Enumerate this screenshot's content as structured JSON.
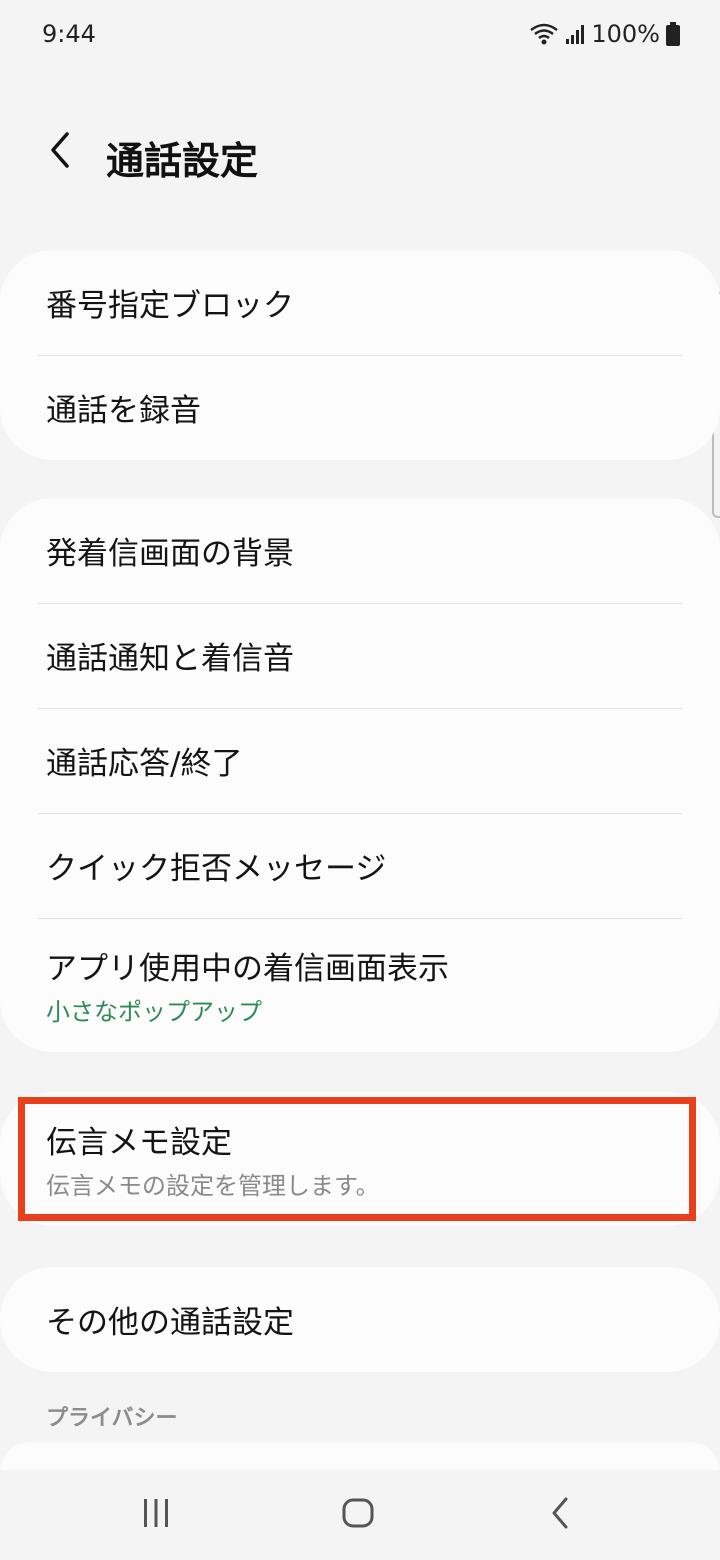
{
  "status_bar": {
    "time": "9:44",
    "battery": "100%",
    "icons": [
      "wifi-icon",
      "signal-icon",
      "battery-icon"
    ]
  },
  "header": {
    "back_icon": "chevron-left-icon",
    "title": "通話設定"
  },
  "group1": {
    "items": [
      {
        "label": "番号指定ブロック"
      },
      {
        "label": "通話を録音"
      }
    ]
  },
  "group2": {
    "items": [
      {
        "label": "発着信画面の背景"
      },
      {
        "label": "通話通知と着信音"
      },
      {
        "label": "通話応答/終了"
      },
      {
        "label": "クイック拒否メッセージ"
      },
      {
        "label": "アプリ使用中の着信画面表示",
        "sub": "小さなポップアップ"
      }
    ]
  },
  "group3": {
    "items": [
      {
        "label": "伝言メモ設定",
        "sub": "伝言メモの設定を管理します。"
      }
    ]
  },
  "group4": {
    "items": [
      {
        "label": "その他の通話設定"
      }
    ]
  },
  "section": {
    "privacy": "プライバシー"
  },
  "nav_bar": {
    "icons": [
      "recents-icon",
      "home-icon",
      "back-icon"
    ]
  },
  "colors": {
    "background": "#f4f4f4",
    "card": "#fcfcfc",
    "accent_green": "#2e8b57",
    "highlight": "#e8401c"
  }
}
